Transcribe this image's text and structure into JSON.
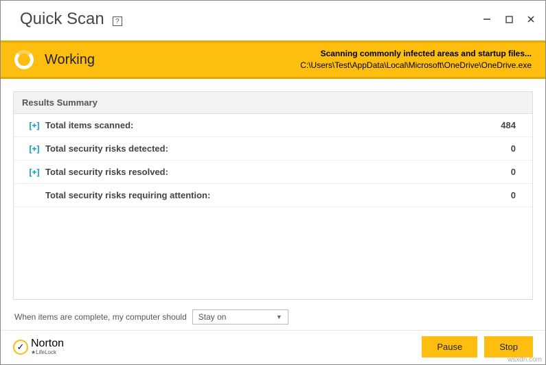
{
  "window": {
    "title": "Quick Scan",
    "help": "?"
  },
  "status": {
    "label": "Working",
    "headline": "Scanning commonly infected areas and startup files...",
    "path": "C:\\Users\\Test\\AppData\\Local\\Microsoft\\OneDrive\\OneDrive.exe"
  },
  "results": {
    "header": "Results Summary",
    "rows": [
      {
        "expand": "[+]",
        "label": "Total items scanned:",
        "value": "484"
      },
      {
        "expand": "[+]",
        "label": "Total security risks detected:",
        "value": "0"
      },
      {
        "expand": "[+]",
        "label": "Total security risks resolved:",
        "value": "0"
      },
      {
        "expand": "",
        "label": "Total security risks requiring attention:",
        "value": "0"
      }
    ]
  },
  "completion": {
    "prompt": "When items are complete, my computer should",
    "selected": "Stay on"
  },
  "footer": {
    "brand_main": "Norton",
    "brand_sub": "★LifeLock",
    "pause": "Pause",
    "stop": "Stop"
  },
  "watermark": "wsxdn.com"
}
